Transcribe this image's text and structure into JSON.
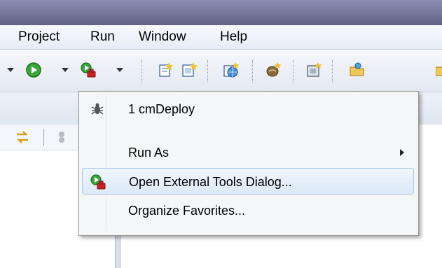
{
  "menubar": {
    "items": [
      {
        "label": "Project"
      },
      {
        "label": "Run"
      },
      {
        "label": "Window"
      },
      {
        "label": "Help"
      }
    ]
  },
  "toolbar": {
    "icons": [
      "dropdown-arrow",
      "run-icon",
      "external-tools-icon",
      "new-file-icon",
      "new-class-icon",
      "web-icon",
      "bean-icon",
      "package-icon",
      "open-folder-icon"
    ]
  },
  "dropdown": {
    "items": [
      {
        "label": "1 cmDeploy",
        "icon": "bug-icon"
      },
      {
        "label": "Run As",
        "has_submenu": true
      },
      {
        "label": "Open External Tools Dialog...",
        "icon": "external-tools-icon",
        "highlighted": true
      },
      {
        "label": "Organize Favorites..."
      }
    ]
  },
  "colors": {
    "highlight_border": "#a9c6ec",
    "menu_bg": "#f5f6f8",
    "titlebar": "#6f7396"
  }
}
